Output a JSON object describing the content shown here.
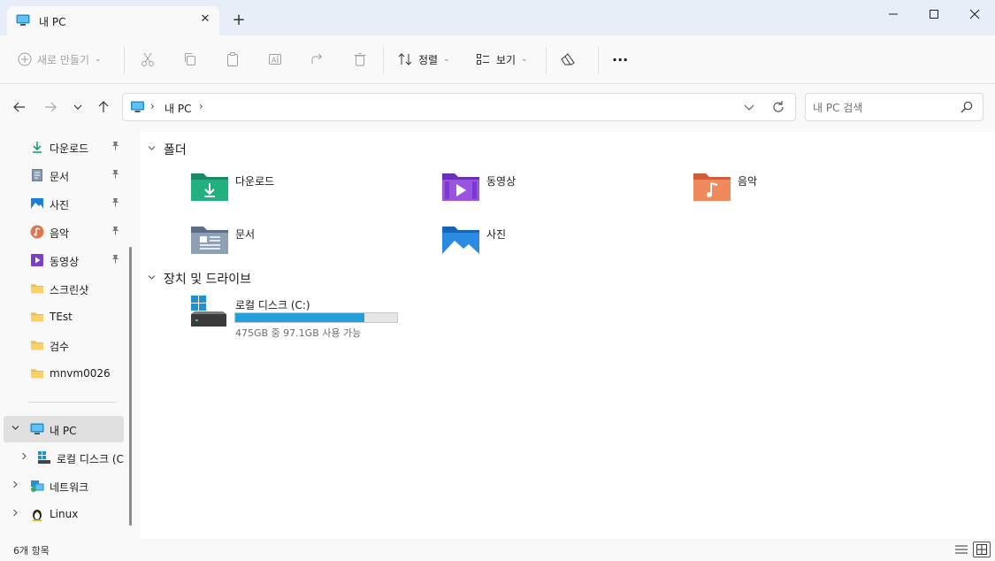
{
  "tab": {
    "title": "내 PC",
    "close_glyph": "✕",
    "new_glyph": "+"
  },
  "toolbar": {
    "new_label": "새로 만들기",
    "sort_label": "정렬",
    "view_label": "보기",
    "more_glyph": "···"
  },
  "address": {
    "path": [
      "내 PC"
    ],
    "sep": "›"
  },
  "search": {
    "placeholder": "내 PC 검색"
  },
  "sidebar": {
    "quick_access": [
      {
        "label": "다운로드",
        "icon": "download-icon",
        "pinned": true
      },
      {
        "label": "문서",
        "icon": "document-icon",
        "pinned": true
      },
      {
        "label": "사진",
        "icon": "picture-icon",
        "pinned": true
      },
      {
        "label": "음악",
        "icon": "music-icon",
        "pinned": true
      },
      {
        "label": "동영상",
        "icon": "video-icon",
        "pinned": true
      },
      {
        "label": "스크린샷",
        "icon": "folder-icon",
        "pinned": false
      },
      {
        "label": "TEst",
        "icon": "folder-icon",
        "pinned": false
      },
      {
        "label": "검수",
        "icon": "folder-icon",
        "pinned": false
      },
      {
        "label": "mnvm0026",
        "icon": "folder-icon",
        "pinned": false
      }
    ],
    "tree": [
      {
        "label": "내 PC",
        "icon": "pc-icon"
      },
      {
        "label": "로컬 디스크 (C:)",
        "icon": "drive-icon"
      },
      {
        "label": "네트워크",
        "icon": "network-icon"
      },
      {
        "label": "Linux",
        "icon": "linux-icon"
      }
    ],
    "pin_glyph": "📌"
  },
  "content": {
    "folders_header": "폴더",
    "folders": [
      {
        "label": "다운로드",
        "icon": "download-folder-icon"
      },
      {
        "label": "동영상",
        "icon": "video-folder-icon"
      },
      {
        "label": "음악",
        "icon": "music-folder-icon"
      },
      {
        "label": "문서",
        "icon": "document-folder-icon"
      },
      {
        "label": "사진",
        "icon": "picture-folder-icon"
      }
    ],
    "drives_header": "장치 및 드라이브",
    "drive": {
      "label": "로컬 디스크 (C:)",
      "free_text": "475GB 중 97.1GB 사용 가능",
      "used_fraction": 0.796
    }
  },
  "status": {
    "item_count": "6개 항목"
  },
  "colors": {
    "accent": "#26a0da",
    "selected": "#e0e0e0",
    "folder_yellow": "#f8c95c"
  }
}
